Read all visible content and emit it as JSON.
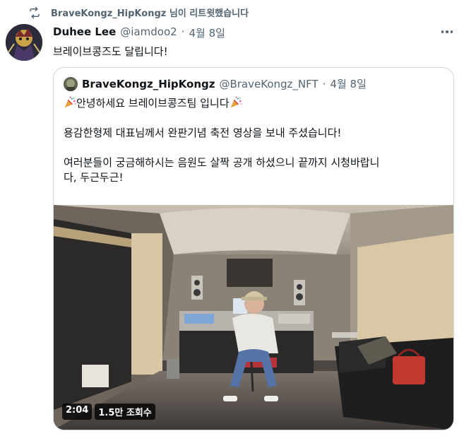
{
  "retweet": {
    "text": "BraveKongz_HipKongz 님이 리트윗했습니다",
    "icon": "retweet-icon"
  },
  "tweet": {
    "author_name": "Duhee Lee",
    "author_handle": "@iamdoo2",
    "separator": "·",
    "date": "4월 8일",
    "text": "브레이브콩즈도 달립니다!",
    "more_icon": "more-icon"
  },
  "quote": {
    "author_name": "BraveKongz_HipKongz",
    "author_handle": "@BraveKongz_NFT",
    "separator": "·",
    "date": "4월 8일",
    "line1_text": "안녕하세요 브레이브콩즈팀 입니다",
    "line2": "용감한형제 대표님께서 완판기념 축전 영상을 보내 주셨습니다!",
    "line3a": "여러분들이 궁금해하시는 음원도 살짝 공개 하셨으니 끝까지 시청바랍니",
    "line3b": "다, 두근두근!",
    "emoji": "party-popper-icon"
  },
  "video": {
    "duration": "2:04",
    "views": "1.5만 조회수"
  },
  "colors": {
    "text": "#0f1419",
    "muted": "#536471",
    "border": "#cfd9de"
  }
}
